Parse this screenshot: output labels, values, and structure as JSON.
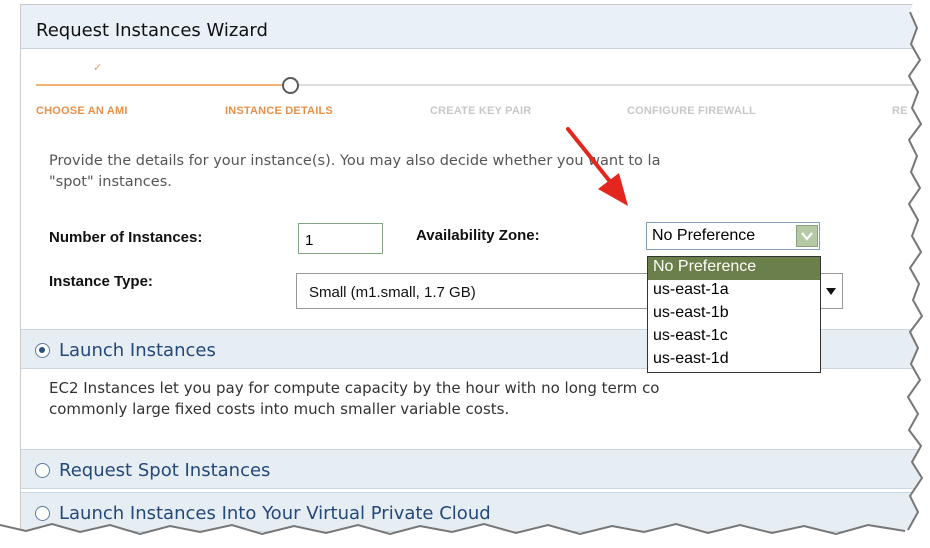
{
  "wizard": {
    "title": "Request Instances Wizard",
    "steps": [
      {
        "label": "CHOOSE AN AMI",
        "state": "done"
      },
      {
        "label": "INSTANCE DETAILS",
        "state": "current"
      },
      {
        "label": "CREATE KEY PAIR",
        "state": "todo"
      },
      {
        "label": "CONFIGURE FIREWALL",
        "state": "todo"
      },
      {
        "label": "RE",
        "state": "todo"
      }
    ],
    "intro_line1": "Provide the details for your instance(s). You may also decide whether you want to la",
    "intro_line2": "\"spot\" instances."
  },
  "form": {
    "num_instances_label": "Number of Instances:",
    "num_instances_value": "1",
    "instance_type_label": "Instance Type:",
    "instance_type_value": "Small (m1.small, 1.7 GB)",
    "availability_zone_label": "Availability Zone:",
    "availability_zone_value": "No Preference",
    "availability_zone_options": [
      "No Preference",
      "us-east-1a",
      "us-east-1b",
      "us-east-1c",
      "us-east-1d"
    ],
    "availability_zone_selected_index": 0
  },
  "sections": [
    {
      "label": "Launch Instances",
      "selected": true
    },
    {
      "label": "Request Spot Instances",
      "selected": false
    },
    {
      "label": "Launch Instances Into Your Virtual Private Cloud",
      "selected": false
    }
  ],
  "launch_description_line1": "EC2 Instances let you pay for compute capacity by the hour with no long term co",
  "launch_description_line2": "commonly large fixed costs into much smaller variable costs.",
  "colors": {
    "step_done": "#e89047",
    "step_todo": "#c8c8c8",
    "dropdown_selected": "#6b7f4a",
    "section_text": "#23487a",
    "annotation_arrow": "#e3261e"
  },
  "icons": {
    "step_done": "checkmark-icon",
    "step_current": "circle-icon",
    "dropdown": "chevron-down-icon",
    "annotation": "red-arrow"
  }
}
